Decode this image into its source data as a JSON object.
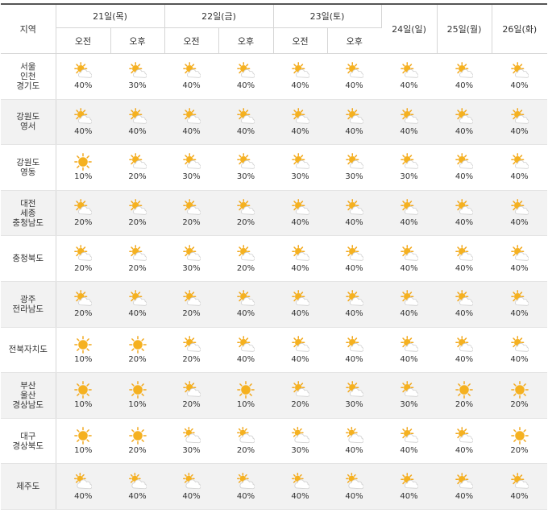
{
  "header": {
    "region_label": "지역",
    "days": [
      {
        "label": "21일(목)",
        "split": true
      },
      {
        "label": "22일(금)",
        "split": true
      },
      {
        "label": "23일(토)",
        "split": true
      },
      {
        "label": "24일(일)",
        "split": false
      },
      {
        "label": "25일(월)",
        "split": false
      },
      {
        "label": "26일(화)",
        "split": false
      }
    ],
    "am_label": "오전",
    "pm_label": "오후"
  },
  "rows": [
    {
      "region": [
        "서울",
        "인천",
        "경기도"
      ],
      "cells": [
        {
          "icon": "partly-cloudy-icon",
          "pct": "40%"
        },
        {
          "icon": "partly-cloudy-icon",
          "pct": "30%"
        },
        {
          "icon": "partly-cloudy-icon",
          "pct": "40%"
        },
        {
          "icon": "partly-cloudy-icon",
          "pct": "40%"
        },
        {
          "icon": "partly-cloudy-icon",
          "pct": "40%"
        },
        {
          "icon": "partly-cloudy-icon",
          "pct": "40%"
        },
        {
          "icon": "partly-cloudy-icon",
          "pct": "40%"
        },
        {
          "icon": "partly-cloudy-icon",
          "pct": "40%"
        },
        {
          "icon": "partly-cloudy-icon",
          "pct": "40%"
        }
      ]
    },
    {
      "region": [
        "강원도",
        "영서"
      ],
      "cells": [
        {
          "icon": "partly-cloudy-icon",
          "pct": "40%"
        },
        {
          "icon": "partly-cloudy-icon",
          "pct": "40%"
        },
        {
          "icon": "partly-cloudy-icon",
          "pct": "40%"
        },
        {
          "icon": "partly-cloudy-icon",
          "pct": "40%"
        },
        {
          "icon": "partly-cloudy-icon",
          "pct": "40%"
        },
        {
          "icon": "partly-cloudy-icon",
          "pct": "40%"
        },
        {
          "icon": "partly-cloudy-icon",
          "pct": "40%"
        },
        {
          "icon": "partly-cloudy-icon",
          "pct": "40%"
        },
        {
          "icon": "partly-cloudy-icon",
          "pct": "40%"
        }
      ]
    },
    {
      "region": [
        "강원도",
        "영동"
      ],
      "cells": [
        {
          "icon": "sunny-icon",
          "pct": "10%"
        },
        {
          "icon": "partly-cloudy-icon",
          "pct": "20%"
        },
        {
          "icon": "partly-cloudy-icon",
          "pct": "30%"
        },
        {
          "icon": "partly-cloudy-icon",
          "pct": "30%"
        },
        {
          "icon": "partly-cloudy-icon",
          "pct": "30%"
        },
        {
          "icon": "partly-cloudy-icon",
          "pct": "30%"
        },
        {
          "icon": "partly-cloudy-icon",
          "pct": "30%"
        },
        {
          "icon": "partly-cloudy-icon",
          "pct": "40%"
        },
        {
          "icon": "partly-cloudy-icon",
          "pct": "40%"
        }
      ]
    },
    {
      "region": [
        "대전",
        "세종",
        "충청남도"
      ],
      "cells": [
        {
          "icon": "partly-cloudy-icon",
          "pct": "20%"
        },
        {
          "icon": "partly-cloudy-icon",
          "pct": "20%"
        },
        {
          "icon": "partly-cloudy-icon",
          "pct": "20%"
        },
        {
          "icon": "partly-cloudy-icon",
          "pct": "20%"
        },
        {
          "icon": "partly-cloudy-icon",
          "pct": "40%"
        },
        {
          "icon": "partly-cloudy-icon",
          "pct": "40%"
        },
        {
          "icon": "partly-cloudy-icon",
          "pct": "40%"
        },
        {
          "icon": "partly-cloudy-icon",
          "pct": "40%"
        },
        {
          "icon": "partly-cloudy-icon",
          "pct": "40%"
        }
      ]
    },
    {
      "region": [
        "충청북도"
      ],
      "cells": [
        {
          "icon": "partly-cloudy-icon",
          "pct": "20%"
        },
        {
          "icon": "partly-cloudy-icon",
          "pct": "20%"
        },
        {
          "icon": "partly-cloudy-icon",
          "pct": "30%"
        },
        {
          "icon": "partly-cloudy-icon",
          "pct": "20%"
        },
        {
          "icon": "partly-cloudy-icon",
          "pct": "40%"
        },
        {
          "icon": "partly-cloudy-icon",
          "pct": "40%"
        },
        {
          "icon": "partly-cloudy-icon",
          "pct": "40%"
        },
        {
          "icon": "partly-cloudy-icon",
          "pct": "40%"
        },
        {
          "icon": "partly-cloudy-icon",
          "pct": "40%"
        }
      ]
    },
    {
      "region": [
        "광주",
        "전라남도"
      ],
      "cells": [
        {
          "icon": "partly-cloudy-icon",
          "pct": "20%"
        },
        {
          "icon": "partly-cloudy-icon",
          "pct": "40%"
        },
        {
          "icon": "partly-cloudy-icon",
          "pct": "20%"
        },
        {
          "icon": "partly-cloudy-icon",
          "pct": "40%"
        },
        {
          "icon": "partly-cloudy-icon",
          "pct": "40%"
        },
        {
          "icon": "partly-cloudy-icon",
          "pct": "40%"
        },
        {
          "icon": "partly-cloudy-icon",
          "pct": "40%"
        },
        {
          "icon": "partly-cloudy-icon",
          "pct": "40%"
        },
        {
          "icon": "partly-cloudy-icon",
          "pct": "40%"
        }
      ]
    },
    {
      "region": [
        "전북자치도"
      ],
      "cells": [
        {
          "icon": "sunny-icon",
          "pct": "10%"
        },
        {
          "icon": "sunny-icon",
          "pct": "20%"
        },
        {
          "icon": "partly-cloudy-icon",
          "pct": "20%"
        },
        {
          "icon": "partly-cloudy-icon",
          "pct": "40%"
        },
        {
          "icon": "partly-cloudy-icon",
          "pct": "40%"
        },
        {
          "icon": "partly-cloudy-icon",
          "pct": "40%"
        },
        {
          "icon": "partly-cloudy-icon",
          "pct": "40%"
        },
        {
          "icon": "partly-cloudy-icon",
          "pct": "40%"
        },
        {
          "icon": "partly-cloudy-icon",
          "pct": "40%"
        }
      ]
    },
    {
      "region": [
        "부산",
        "울산",
        "경상남도"
      ],
      "cells": [
        {
          "icon": "sunny-icon",
          "pct": "10%"
        },
        {
          "icon": "sunny-icon",
          "pct": "10%"
        },
        {
          "icon": "partly-cloudy-icon",
          "pct": "20%"
        },
        {
          "icon": "sunny-icon",
          "pct": "10%"
        },
        {
          "icon": "partly-cloudy-icon",
          "pct": "20%"
        },
        {
          "icon": "partly-cloudy-icon",
          "pct": "30%"
        },
        {
          "icon": "partly-cloudy-icon",
          "pct": "30%"
        },
        {
          "icon": "sunny-icon",
          "pct": "20%"
        },
        {
          "icon": "sunny-icon",
          "pct": "20%"
        }
      ]
    },
    {
      "region": [
        "대구",
        "경상북도"
      ],
      "cells": [
        {
          "icon": "sunny-icon",
          "pct": "10%"
        },
        {
          "icon": "sunny-icon",
          "pct": "20%"
        },
        {
          "icon": "mostly-cloudy-icon",
          "pct": "30%"
        },
        {
          "icon": "mostly-cloudy-icon",
          "pct": "20%"
        },
        {
          "icon": "mostly-cloudy-icon",
          "pct": "30%"
        },
        {
          "icon": "mostly-cloudy-icon",
          "pct": "40%"
        },
        {
          "icon": "partly-cloudy-icon",
          "pct": "40%"
        },
        {
          "icon": "partly-cloudy-icon",
          "pct": "40%"
        },
        {
          "icon": "sunny-icon",
          "pct": "20%"
        }
      ]
    },
    {
      "region": [
        "제주도"
      ],
      "cells": [
        {
          "icon": "mostly-cloudy-icon",
          "pct": "40%"
        },
        {
          "icon": "mostly-cloudy-icon",
          "pct": "40%"
        },
        {
          "icon": "mostly-cloudy-icon",
          "pct": "40%"
        },
        {
          "icon": "mostly-cloudy-icon",
          "pct": "40%"
        },
        {
          "icon": "mostly-cloudy-icon",
          "pct": "40%"
        },
        {
          "icon": "mostly-cloudy-icon",
          "pct": "40%"
        },
        {
          "icon": "partly-cloudy-icon",
          "pct": "40%"
        },
        {
          "icon": "partly-cloudy-icon",
          "pct": "40%"
        },
        {
          "icon": "partly-cloudy-icon",
          "pct": "40%"
        }
      ]
    }
  ],
  "colors": {
    "sun": "#f5b120",
    "sun_ray": "#f2a81d",
    "cloud": "#ffffff",
    "cloud_stroke": "#d0d0d0",
    "grid": "#d6d6d6",
    "alt_row": "#f2f2f2",
    "text": "#333333"
  }
}
